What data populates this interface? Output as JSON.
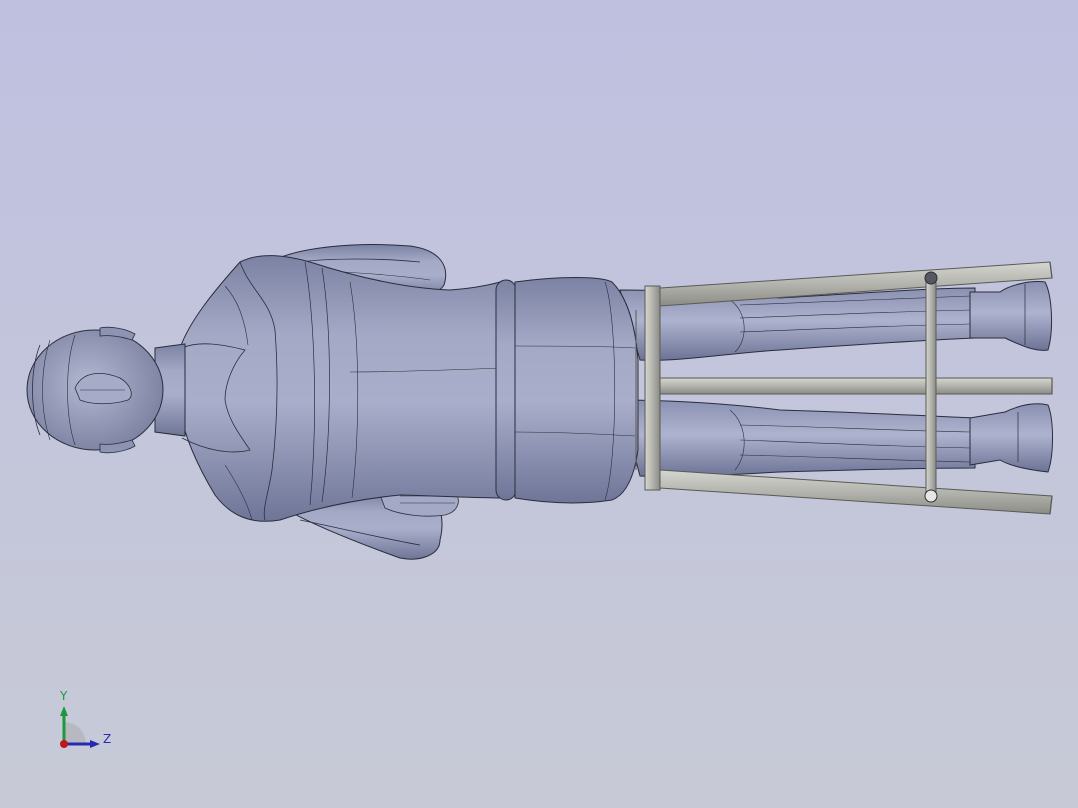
{
  "viewport": {
    "background_top": "#bfc0e0",
    "background_bottom": "#c7cad6",
    "model_color": "#9aa0bd",
    "frame_color": "#b5b5b0"
  },
  "triad": {
    "y_label": "Y",
    "z_label": "Z",
    "y_color": "#1a9a3a",
    "z_color": "#2a2ab0",
    "x_color": "#c01818"
  }
}
